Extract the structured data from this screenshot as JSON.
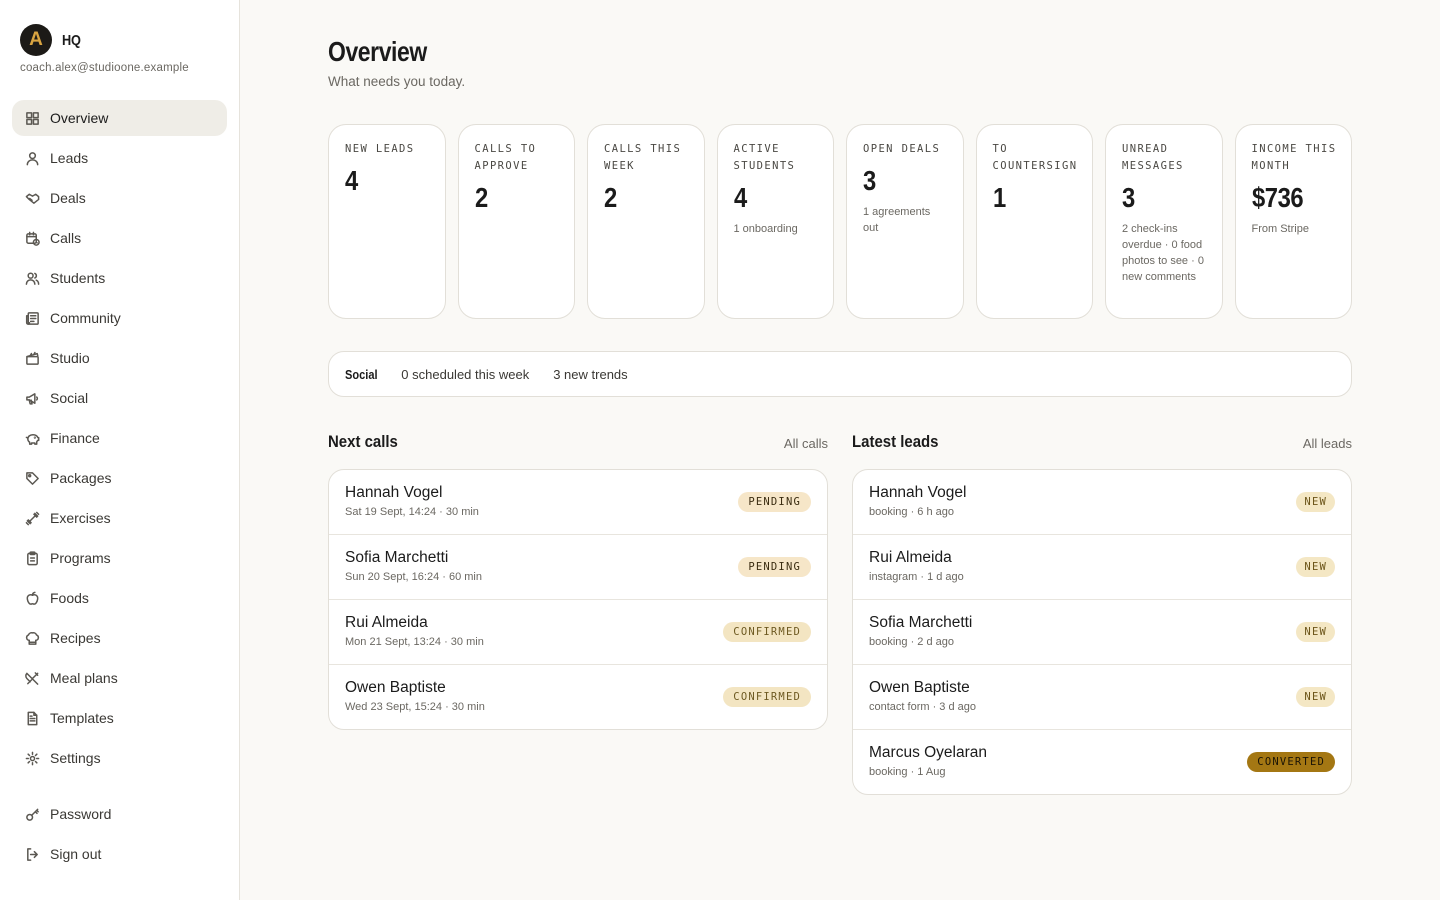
{
  "brand": {
    "logo_letter": "A",
    "name": "HQ",
    "email": "coach.alex@studioone.example"
  },
  "sidebar": {
    "items": [
      {
        "label": "Overview",
        "icon": "grid-icon",
        "active": true
      },
      {
        "label": "Leads",
        "icon": "user-icon"
      },
      {
        "label": "Deals",
        "icon": "handshake-icon"
      },
      {
        "label": "Calls",
        "icon": "calendar-clock-icon"
      },
      {
        "label": "Students",
        "icon": "users-icon"
      },
      {
        "label": "Community",
        "icon": "newspaper-icon"
      },
      {
        "label": "Studio",
        "icon": "clapperboard-icon"
      },
      {
        "label": "Social",
        "icon": "megaphone-icon"
      },
      {
        "label": "Finance",
        "icon": "piggy-bank-icon"
      },
      {
        "label": "Packages",
        "icon": "tag-icon"
      },
      {
        "label": "Exercises",
        "icon": "dumbbell-icon"
      },
      {
        "label": "Programs",
        "icon": "clipboard-icon"
      },
      {
        "label": "Foods",
        "icon": "apple-icon"
      },
      {
        "label": "Recipes",
        "icon": "chef-hat-icon"
      },
      {
        "label": "Meal plans",
        "icon": "utensils-icon"
      },
      {
        "label": "Templates",
        "icon": "file-text-icon"
      },
      {
        "label": "Settings",
        "icon": "gear-icon"
      }
    ],
    "bottom": [
      {
        "label": "Password",
        "icon": "key-icon"
      },
      {
        "label": "Sign out",
        "icon": "logout-icon"
      }
    ]
  },
  "header": {
    "title": "Overview",
    "subtitle": "What needs you today."
  },
  "stats": [
    {
      "label": "New leads",
      "value": "4",
      "note": ""
    },
    {
      "label": "Calls to approve",
      "value": "2",
      "note": ""
    },
    {
      "label": "Calls this week",
      "value": "2",
      "note": ""
    },
    {
      "label": "Active students",
      "value": "4",
      "note": "1 onboarding"
    },
    {
      "label": "Open deals",
      "value": "3",
      "note": "1 agreements out"
    },
    {
      "label": "To countersign",
      "value": "1",
      "note": ""
    },
    {
      "label": "Unread messages",
      "value": "3",
      "note": "2 check-ins overdue · 0 food photos to see · 0 new comments"
    },
    {
      "label": "Income this month",
      "value": "$736",
      "note": "From Stripe"
    }
  ],
  "social": {
    "label": "Social",
    "scheduled": "0 scheduled this week",
    "trends": "3 new trends"
  },
  "next_calls": {
    "title": "Next calls",
    "link": "All calls",
    "rows": [
      {
        "name": "Hannah Vogel",
        "meta": "Sat 19 Sept, 14:24 · 30 min",
        "status": "Pending",
        "kind": "pending"
      },
      {
        "name": "Sofia Marchetti",
        "meta": "Sun 20 Sept, 16:24 · 60 min",
        "status": "Pending",
        "kind": "pending"
      },
      {
        "name": "Rui Almeida",
        "meta": "Mon 21 Sept, 13:24 · 30 min",
        "status": "Confirmed",
        "kind": "confirmed"
      },
      {
        "name": "Owen Baptiste",
        "meta": "Wed 23 Sept, 15:24 · 30 min",
        "status": "Confirmed",
        "kind": "confirmed"
      }
    ]
  },
  "latest_leads": {
    "title": "Latest leads",
    "link": "All leads",
    "rows": [
      {
        "name": "Hannah Vogel",
        "meta": "booking · 6 h ago",
        "status": "New",
        "kind": "new"
      },
      {
        "name": "Rui Almeida",
        "meta": "instagram · 1 d ago",
        "status": "New",
        "kind": "new"
      },
      {
        "name": "Sofia Marchetti",
        "meta": "booking · 2 d ago",
        "status": "New",
        "kind": "new"
      },
      {
        "name": "Owen Baptiste",
        "meta": "contact form · 3 d ago",
        "status": "New",
        "kind": "new"
      },
      {
        "name": "Marcus Oyelaran",
        "meta": "booking · 1 Aug",
        "status": "Converted",
        "kind": "converted"
      }
    ]
  },
  "colors": {
    "accent": "#d9a441",
    "converted": "#a47713",
    "pending_bg": "#f6e6c8",
    "background": "#faf9f6"
  }
}
